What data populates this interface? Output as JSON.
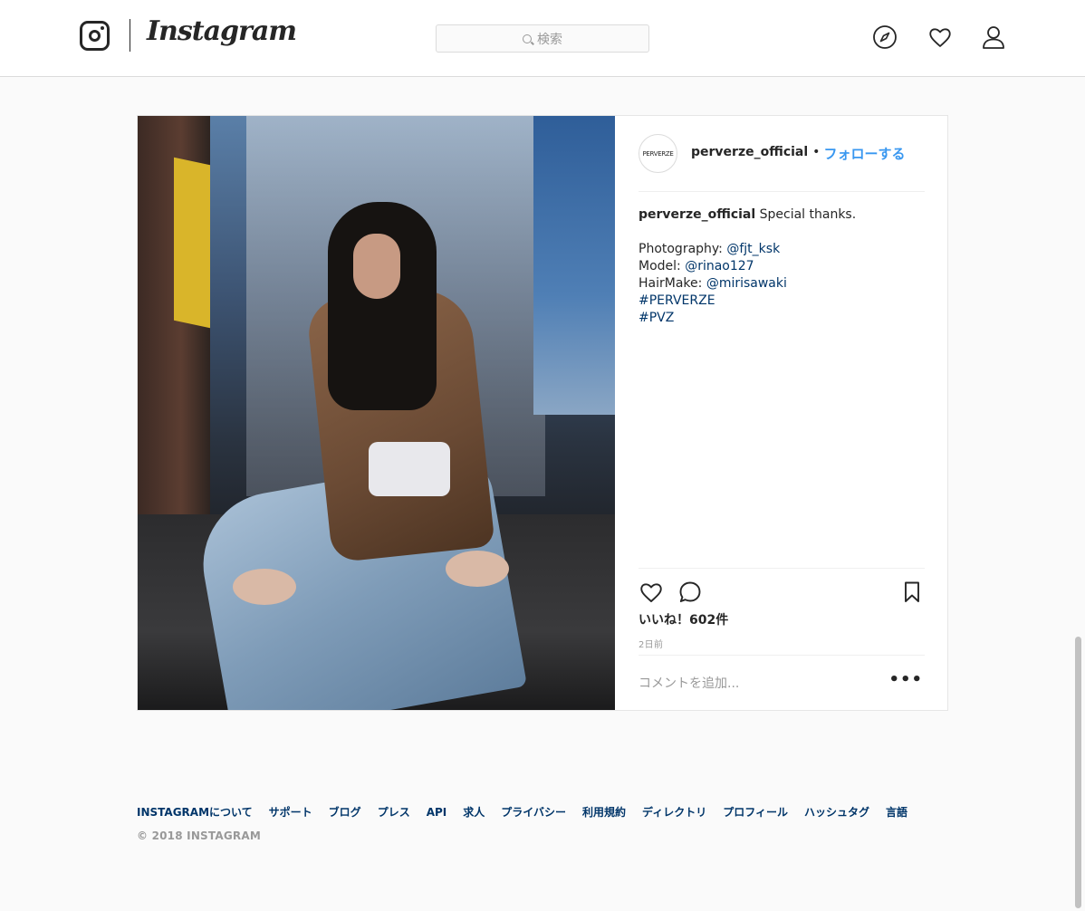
{
  "header": {
    "logo_text": "Instagram",
    "search_placeholder": "検索",
    "nav_icons": [
      "compass-icon",
      "heart-icon",
      "user-icon"
    ]
  },
  "post": {
    "username": "perverze_official",
    "avatar_text": "PERVERZE",
    "separator": "•",
    "follow_label": "フォローする",
    "caption": {
      "username": "perverze_official",
      "text": " Special thanks.",
      "credits": [
        {
          "label": "Photography: ",
          "mention": "@fjt_ksk"
        },
        {
          "label": "Model: ",
          "mention": "@rinao127"
        },
        {
          "label": "HairMake: ",
          "mention": "@mirisawaki"
        }
      ],
      "hashtags": [
        "#PERVERZE",
        "#PVZ"
      ]
    },
    "likes_text": "いいね！602件",
    "time_text": "2日前",
    "comment_placeholder": "コメントを追加...",
    "more_label": "•••"
  },
  "footer": {
    "links": [
      "INSTAGRAMについて",
      "サポート",
      "ブログ",
      "プレス",
      "API",
      "求人",
      "プライバシー",
      "利用規約",
      "ディレクトリ",
      "プロフィール",
      "ハッシュタグ",
      "言語"
    ],
    "copyright": "© 2018 INSTAGRAM"
  },
  "colors": {
    "link_blue": "#3897f0",
    "mention_blue": "#003569",
    "text": "#262626",
    "muted": "#999999",
    "border": "#dbdbdb",
    "background": "#fafafa"
  }
}
